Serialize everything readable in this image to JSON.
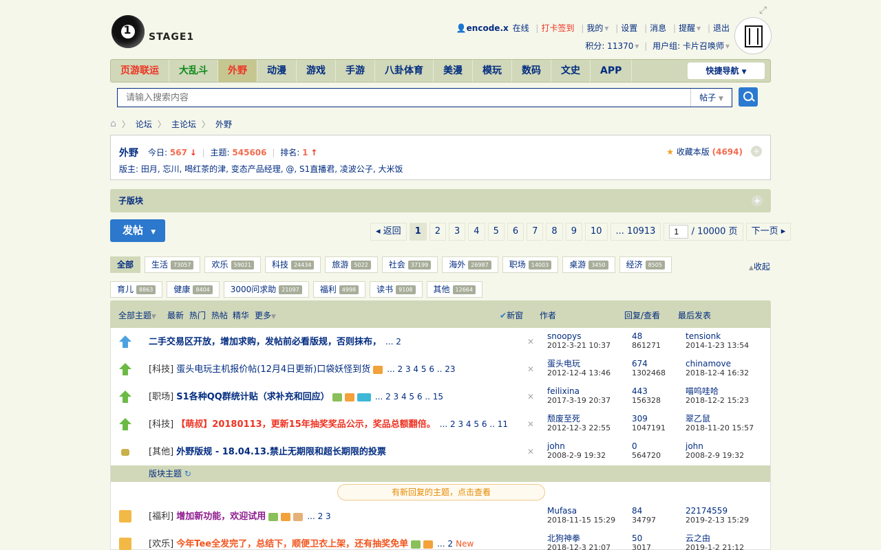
{
  "header": {
    "logo_text": "STAGE1",
    "user": "encode.x",
    "online": "在线",
    "checkin": "打卡签到",
    "mine": "我的",
    "settings": "设置",
    "messages": "消息",
    "alerts": "提醒",
    "logout": "退出",
    "points_label": "积分: 11370",
    "group_label": "用户组: 卡片召唤师"
  },
  "nav": {
    "items": [
      "页游联运",
      "大乱斗",
      "外野",
      "动漫",
      "游戏",
      "手游",
      "八卦体育",
      "美漫",
      "模玩",
      "数码",
      "文史",
      "APP"
    ],
    "quick": "快捷导航"
  },
  "search": {
    "placeholder": "请输入搜索内容",
    "type": "帖子"
  },
  "breadcrumb": [
    "论坛",
    "主论坛",
    "外野"
  ],
  "forum": {
    "name": "外野",
    "today_label": "今日:",
    "today": "567",
    "topics_label": "主题:",
    "topics": "545606",
    "rank_label": "排名:",
    "rank": "1",
    "mods": "版主: 田月, 忘川, 喝红茶的津, 变态产品经理, @, S1直播君, 凌波公子, 大米饭",
    "fav_label": "收藏本版",
    "fav_count": "(4694)",
    "subforum": "子版块"
  },
  "post_btn": "发帖",
  "pagination": {
    "back": "返回",
    "pages": [
      "1",
      "2",
      "3",
      "4",
      "5",
      "6",
      "7",
      "8",
      "9",
      "10"
    ],
    "last": "... 10913",
    "input": "1",
    "total": "/ 10000 页",
    "next": "下一页"
  },
  "tags": [
    {
      "name": "全部",
      "count": ""
    },
    {
      "name": "生活",
      "count": "73057"
    },
    {
      "name": "欢乐",
      "count": "59021"
    },
    {
      "name": "科技",
      "count": "24434"
    },
    {
      "name": "旅游",
      "count": "5022"
    },
    {
      "name": "社会",
      "count": "37199"
    },
    {
      "name": "海外",
      "count": "26987"
    },
    {
      "name": "职场",
      "count": "14003"
    },
    {
      "name": "桌游",
      "count": "3450"
    },
    {
      "name": "经济",
      "count": "8505"
    },
    {
      "name": "育儿",
      "count": "8863"
    },
    {
      "name": "健康",
      "count": "8404"
    },
    {
      "name": "3000问求助",
      "count": "21097"
    },
    {
      "name": "福利",
      "count": "4998"
    },
    {
      "name": "读书",
      "count": "9108"
    },
    {
      "name": "其他",
      "count": "12664"
    }
  ],
  "collapse": "收起",
  "table_head": {
    "all": "全部主题",
    "latest": "最新",
    "hot": "热门",
    "hotpost": "热帖",
    "digest": "精华",
    "more": "更多",
    "newwin": "新窗",
    "author": "作者",
    "reply": "回复/查看",
    "last": "最后发表"
  },
  "rows": [
    {
      "cat": "",
      "title": "二手交易区开放，增加求购，发帖前必看版规，否则抹布，",
      "pages": "... 2",
      "author": "snoopys",
      "adate": "2012-3-21 10:37",
      "replies": "48",
      "views": "861271",
      "last": "tensionk",
      "ldate": "2014-1-23 13:54"
    },
    {
      "cat": "[科技]",
      "title": "蛋头电玩主机报价帖(12月4日更新)口袋妖怪到货",
      "pages": "... 2 3 4 5 6 .. 23",
      "author": "蛋头电玩",
      "adate": "2012-12-4 13:46",
      "replies": "674",
      "views": "1302468",
      "last": "chinamove",
      "ldate": "2018-12-4 16:32"
    },
    {
      "cat": "[职场]",
      "title": "S1各种QQ群统计贴（求补充和回应）",
      "pages": "... 2 3 4 5 6 .. 15",
      "author": "feilixina",
      "adate": "2017-3-19 20:37",
      "replies": "443",
      "views": "156328",
      "last": "喵呜哇哈",
      "ldate": "2018-12-2 15:23"
    },
    {
      "cat": "[科技]",
      "title": "【萌叔】20180113，更新15年抽奖奖品公示，奖品总额翻倍。",
      "pages": "... 2 3 4 5 6 .. 11",
      "author": "颓废至死",
      "adate": "2012-12-3 22:55",
      "replies": "309",
      "views": "1047191",
      "last": "翠乙鼠",
      "ldate": "2018-11-20 15:57"
    },
    {
      "cat": "[其他]",
      "title": "外野版规 - 18.04.13.禁止无期限和超长期限的投票",
      "pages": "",
      "author": "john",
      "adate": "2008-2-9 19:32",
      "replies": "0",
      "views": "564720",
      "last": "john",
      "ldate": "2008-2-9 19:32"
    },
    {
      "cat": "[福利]",
      "title": "增加新功能，欢迎试用",
      "pages": "... 2 3",
      "author": "Mufasa",
      "adate": "2018-11-15 15:29",
      "replies": "84",
      "views": "34797",
      "last": "22174559",
      "ldate": "2019-2-13 15:29"
    },
    {
      "cat": "[欢乐]",
      "title": "今年Tee全发完了，总结下，顺便卫衣上架，还有抽奖免单",
      "pages": "... 2",
      "new": "New",
      "author": "北狗神拳",
      "adate": "2018-12-3 21:07",
      "replies": "50",
      "views": "3017",
      "last": "云之由",
      "ldate": "2019-1-2 21:12"
    }
  ],
  "section_label": "版块主题",
  "new_reply_bar": "有新回复的主题，点击查看",
  "colors": {
    "accent": "#022c80",
    "nav_bg": "#d1d8b9",
    "red": "#e32",
    "count": "#f26c4f"
  }
}
